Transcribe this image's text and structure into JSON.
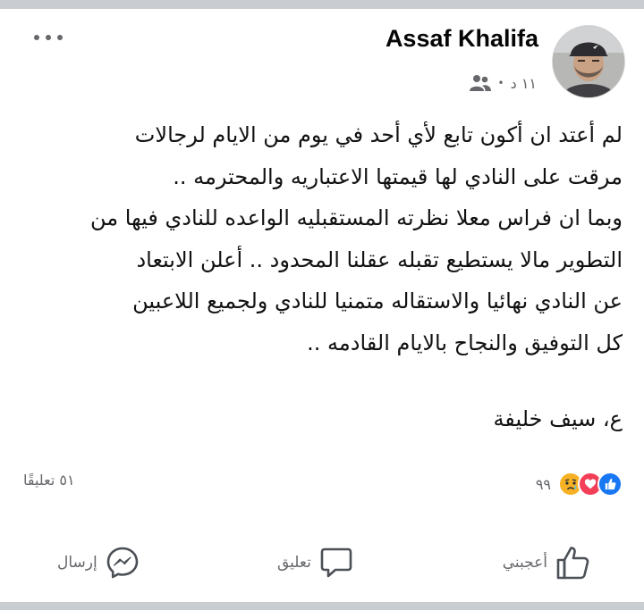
{
  "post": {
    "author": "Assaf Khalifa",
    "timestamp": "١١ د",
    "separator": "•",
    "audience_icon": "friends-icon",
    "body": "لم أعتد ان أكون تابع لأي أحد في يوم من الايام لرجالات\nمرقت على النادي لها قيمتها الاعتباريه والمحترمه ..\nوبما ان فراس معلا نظرته المستقبليه الواعده للنادي فيها من\nالتطوير مالا يستطيع تقبله عقلنا المحدود .. أعلن الابتعاد\nعن النادي نهائيا والاستقاله  متمنيا للنادي ولجميع اللاعبين\nكل التوفيق والنجاح بالايام القادمه ..",
    "signature": "ع، سيف خليفة"
  },
  "reactions": {
    "types": [
      "like",
      "love",
      "sad"
    ],
    "count": "٩٩"
  },
  "comments": {
    "count_label": "٥١ تعليقًا"
  },
  "actions": {
    "like": "أعجبني",
    "comment": "تعليق",
    "send": "إرسال"
  },
  "colors": {
    "like_blue": "#1877f2",
    "love_red": "#f33e58",
    "sad_yellow": "#f7b125",
    "meta_gray": "#65676b"
  }
}
